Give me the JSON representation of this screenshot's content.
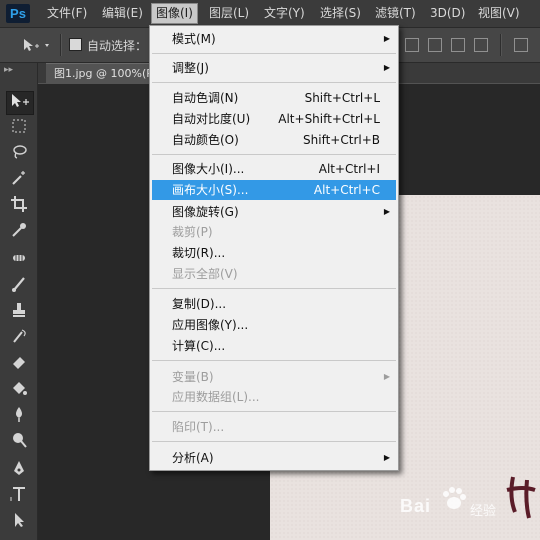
{
  "app": {
    "logo": "Ps"
  },
  "menubar": {
    "items": [
      {
        "label": "文件(F)"
      },
      {
        "label": "编辑(E)"
      },
      {
        "label": "图像(I)"
      },
      {
        "label": "图层(L)"
      },
      {
        "label": "文字(Y)"
      },
      {
        "label": "选择(S)"
      },
      {
        "label": "滤镜(T)"
      },
      {
        "label": "3D(D)"
      },
      {
        "label": "视图(V)"
      }
    ]
  },
  "options_bar": {
    "auto_select_label": "自动选择：",
    "auto_select_checked": false
  },
  "document": {
    "tab_title": "图1.jpg @ 100%(R"
  },
  "toolbox": {
    "tools": [
      {
        "icon": "move-icon"
      },
      {
        "icon": "marquee-icon"
      },
      {
        "icon": "lasso-icon"
      },
      {
        "icon": "magic-wand-icon"
      },
      {
        "icon": "crop-icon"
      },
      {
        "icon": "eyedropper-icon"
      },
      {
        "icon": "healing-brush-icon"
      },
      {
        "icon": "brush-icon"
      },
      {
        "icon": "clone-stamp-icon"
      },
      {
        "icon": "history-brush-icon"
      },
      {
        "icon": "eraser-icon"
      },
      {
        "icon": "paint-bucket-icon"
      },
      {
        "icon": "blur-icon"
      },
      {
        "icon": "dodge-icon"
      },
      {
        "icon": "pen-icon"
      },
      {
        "icon": "type-icon"
      },
      {
        "icon": "path-selection-icon"
      }
    ]
  },
  "image_menu": {
    "items": [
      {
        "label": "模式(M)",
        "shortcut": "",
        "submenu": true,
        "disabled": false
      },
      {
        "label": "调整(J)",
        "shortcut": "",
        "submenu": true,
        "disabled": false
      },
      {
        "label": "自动色调(N)",
        "shortcut": "Shift+Ctrl+L",
        "submenu": false,
        "disabled": false
      },
      {
        "label": "自动对比度(U)",
        "shortcut": "Alt+Shift+Ctrl+L",
        "submenu": false,
        "disabled": false
      },
      {
        "label": "自动颜色(O)",
        "shortcut": "Shift+Ctrl+B",
        "submenu": false,
        "disabled": false
      },
      {
        "label": "图像大小(I)...",
        "shortcut": "Alt+Ctrl+I",
        "submenu": false,
        "disabled": false
      },
      {
        "label": "画布大小(S)...",
        "shortcut": "Alt+Ctrl+C",
        "submenu": false,
        "disabled": false,
        "highlighted": true
      },
      {
        "label": "图像旋转(G)",
        "shortcut": "",
        "submenu": true,
        "disabled": false
      },
      {
        "label": "裁剪(P)",
        "shortcut": "",
        "submenu": false,
        "disabled": true
      },
      {
        "label": "裁切(R)...",
        "shortcut": "",
        "submenu": false,
        "disabled": false
      },
      {
        "label": "显示全部(V)",
        "shortcut": "",
        "submenu": false,
        "disabled": true
      },
      {
        "label": "复制(D)...",
        "shortcut": "",
        "submenu": false,
        "disabled": false
      },
      {
        "label": "应用图像(Y)...",
        "shortcut": "",
        "submenu": false,
        "disabled": false
      },
      {
        "label": "计算(C)...",
        "shortcut": "",
        "submenu": false,
        "disabled": false
      },
      {
        "label": "变量(B)",
        "shortcut": "",
        "submenu": true,
        "disabled": true
      },
      {
        "label": "应用数据组(L)...",
        "shortcut": "",
        "submenu": false,
        "disabled": true
      },
      {
        "label": "陷印(T)...",
        "shortcut": "",
        "submenu": false,
        "disabled": true
      },
      {
        "label": "分析(A)",
        "shortcut": "",
        "submenu": true,
        "disabled": false
      }
    ]
  },
  "watermark": {
    "brand": "Bai",
    "brand_suffix": "经验"
  },
  "colors": {
    "highlight": "#3399e6",
    "menu_bg": "#f0f0f0",
    "app_bg": "#282828"
  }
}
